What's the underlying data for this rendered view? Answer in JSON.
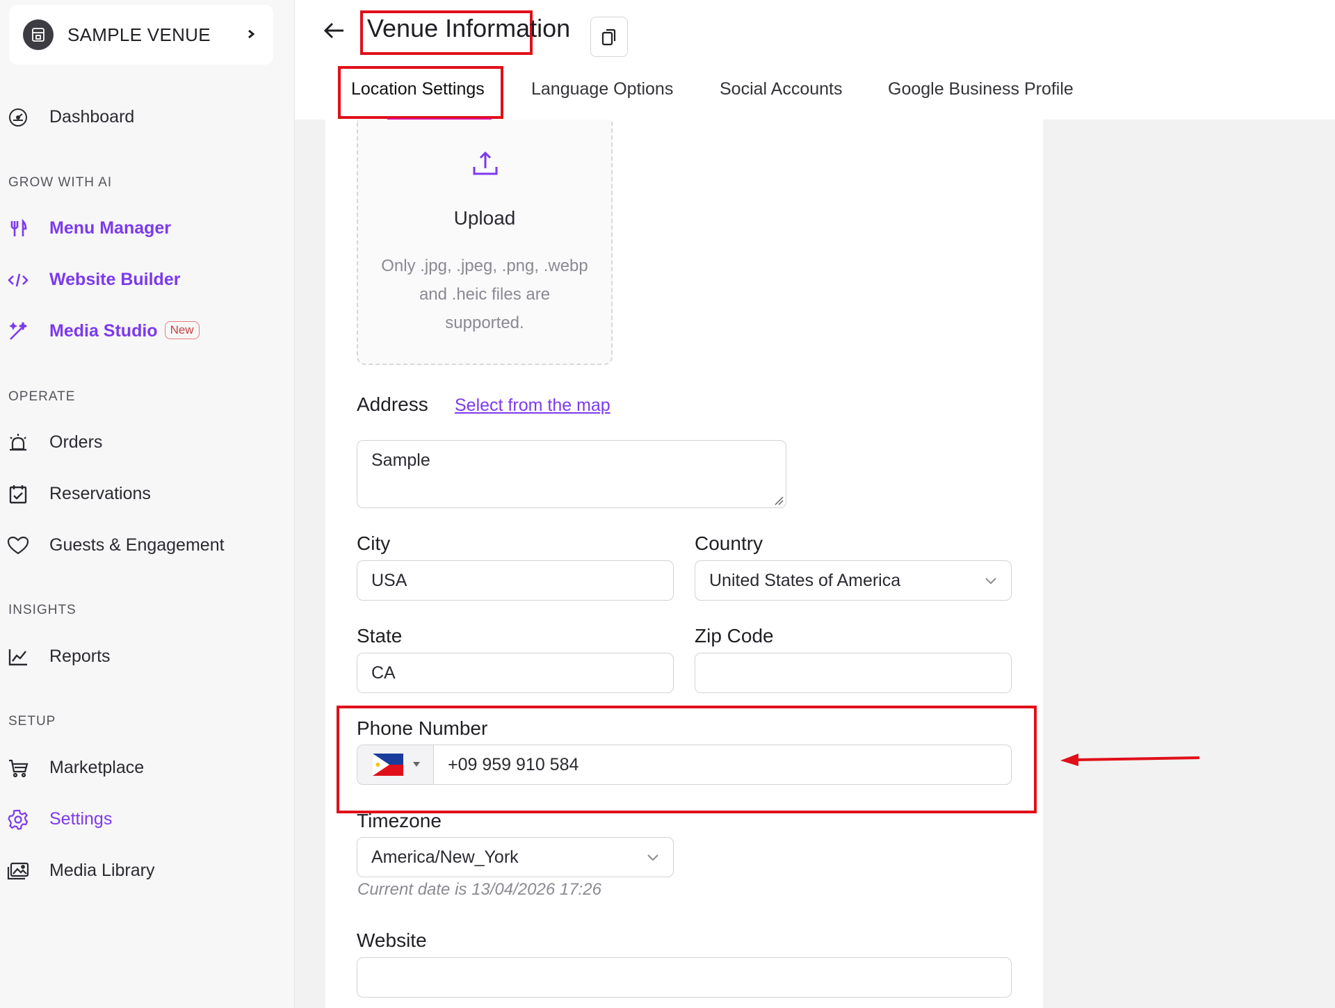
{
  "venue": {
    "name": "SAMPLE VENUE"
  },
  "sidebar": {
    "dashboard": "Dashboard",
    "sections": {
      "grow": "GROW WITH AI",
      "operate": "OPERATE",
      "insights": "INSIGHTS",
      "setup": "SETUP"
    },
    "grow_items": [
      {
        "label": "Menu Manager",
        "icon": "cutlery-icon"
      },
      {
        "label": "Website Builder",
        "icon": "code-icon"
      },
      {
        "label": "Media Studio",
        "icon": "magic-wand-icon",
        "badge": "New"
      }
    ],
    "operate_items": [
      {
        "label": "Orders",
        "icon": "alarm-icon"
      },
      {
        "label": "Reservations",
        "icon": "calendar-check-icon"
      },
      {
        "label": "Guests & Engagement",
        "icon": "heart-icon"
      }
    ],
    "insights_items": [
      {
        "label": "Reports",
        "icon": "line-chart-icon"
      }
    ],
    "setup_items": [
      {
        "label": "Marketplace",
        "icon": "cart-icon"
      },
      {
        "label": "Settings",
        "icon": "gear-icon",
        "active": true
      },
      {
        "label": "Media Library",
        "icon": "images-icon"
      }
    ]
  },
  "header": {
    "title": "Venue Information",
    "tabs": [
      "Location Settings",
      "Language Options",
      "Social Accounts",
      "Google Business Profile"
    ],
    "active_tab": "Location Settings"
  },
  "upload": {
    "title": "Upload",
    "hint": "Only .jpg, .jpeg, .png, .webp and .heic files are supported."
  },
  "form": {
    "address_label": "Address",
    "address_link": "Select from the map",
    "address_value": "Sample",
    "city_label": "City",
    "city_value": "USA",
    "country_label": "Country",
    "country_value": "United States of America",
    "state_label": "State",
    "state_value": "CA",
    "zip_label": "Zip Code",
    "zip_value": "",
    "phone_label": "Phone Number",
    "phone_value": "+09 959 910 584",
    "phone_country_flag": "philippines-flag-icon",
    "timezone_label": "Timezone",
    "timezone_value": "America/New_York",
    "timezone_help": "Current date is 13/04/2026 17:26",
    "website_label": "Website",
    "website_value": ""
  },
  "colors": {
    "accent": "#7c3aed",
    "highlight": "#e0101a"
  }
}
